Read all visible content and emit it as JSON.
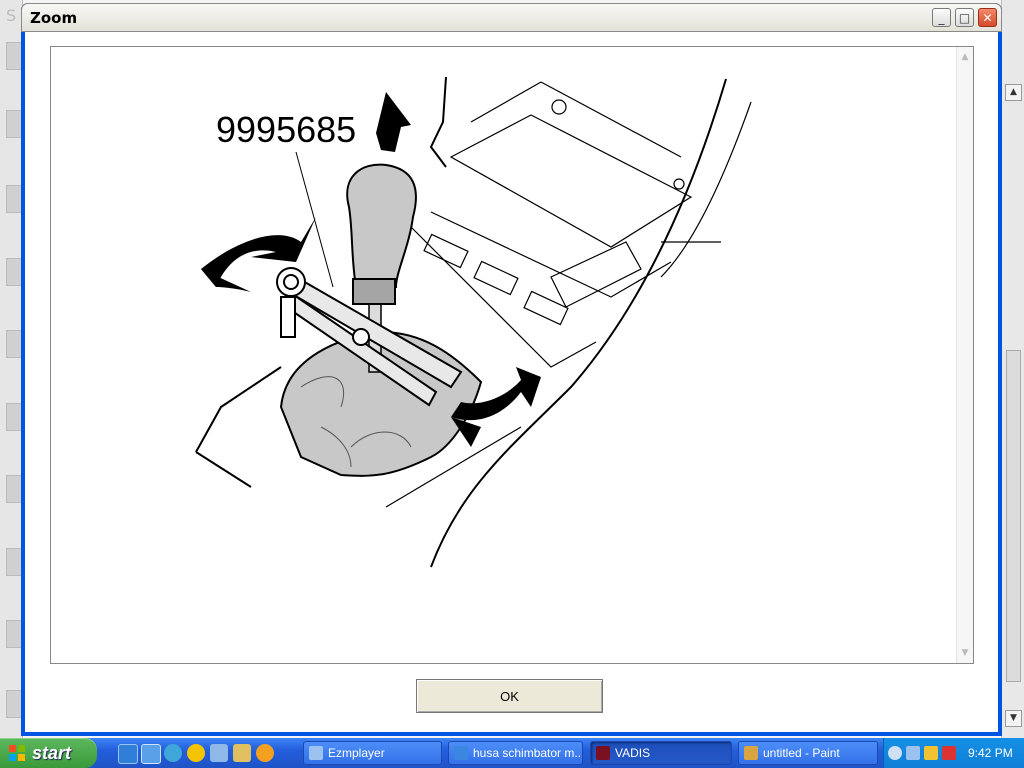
{
  "window": {
    "title": "Zoom",
    "ok_label": "OK",
    "minimize_label": "_",
    "maximize_label": "□",
    "close_label": "✕"
  },
  "diagram": {
    "part_number": "9995685"
  },
  "background_app": {
    "left_text": "S"
  },
  "taskbar": {
    "start_label": "start",
    "tasks": [
      {
        "label": "Ezmplayer",
        "icon": "ezmplayer-icon"
      },
      {
        "label": "husa schimbator m...",
        "icon": "ie-icon"
      },
      {
        "label": "VADIS",
        "icon": "vadis-icon"
      },
      {
        "label": "untitled - Paint",
        "icon": "paint-icon"
      }
    ],
    "quick_launch": [
      "ie-icon",
      "ie-alt-icon",
      "messenger-icon",
      "smiley-icon",
      "media-icon",
      "tool-icon",
      "player-icon"
    ],
    "clock": "9:42 PM"
  },
  "colors": {
    "titlebar_bg": "#ece9d8",
    "taskbar": "#245edc",
    "start_button": "#3a9a3a",
    "tray": "#0f7fd6",
    "diagram_fill": "#c8c8c8"
  }
}
